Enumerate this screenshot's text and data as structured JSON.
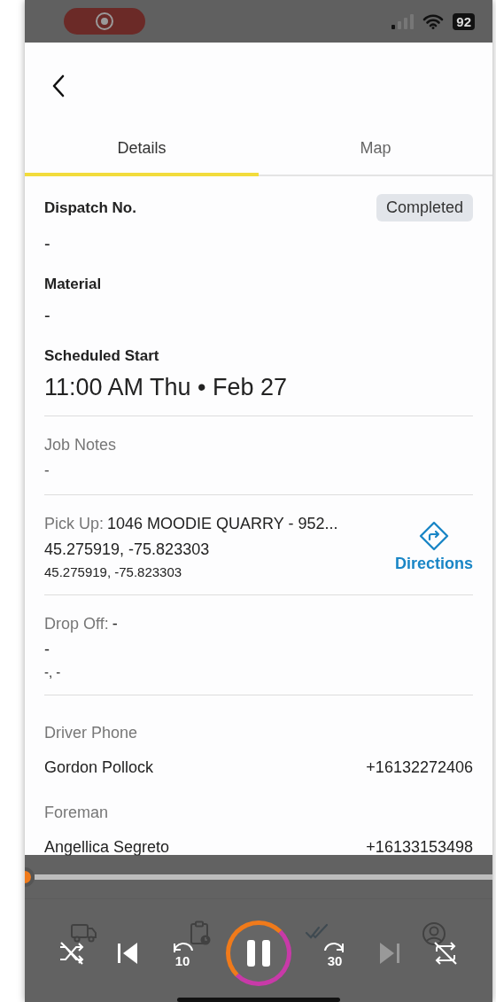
{
  "status_bar": {
    "battery": "92",
    "recording": true
  },
  "tabs": [
    {
      "label": "Details",
      "selected": true
    },
    {
      "label": "Map",
      "selected": false
    }
  ],
  "fields": [
    {
      "kind": "heading",
      "label": "Dispatch No.",
      "value": "-",
      "badge": "Completed"
    },
    {
      "kind": "heading",
      "label": "Material",
      "value": "-"
    },
    {
      "kind": "large",
      "label": "Scheduled Start",
      "value": "11:00 AM Thu • Feb 27"
    }
  ],
  "sections": [
    {
      "kind": "note",
      "label": "Job Notes",
      "lines": [
        "-"
      ]
    },
    {
      "kind": "location",
      "label": "Pick Up:",
      "name": "1046 MOODIE QUARRY - 952...",
      "lines": [
        "45.275919, -75.823303",
        "45.275919, -75.823303"
      ],
      "action": "Directions"
    },
    {
      "kind": "location",
      "label": "Drop Off:",
      "name": "-",
      "lines": [
        "-",
        "-, -"
      ]
    },
    {
      "kind": "contacts",
      "items": [
        {
          "label": "Driver Phone",
          "name": "Gordon Pollock",
          "phone": "+16132272406"
        },
        {
          "label": "Foreman",
          "name": "Angellica Segreto",
          "phone": "+16133153498"
        }
      ]
    }
  ],
  "nav": [
    {
      "selected": false
    },
    {
      "selected": false
    },
    {
      "selected": true
    },
    {
      "selected": false
    }
  ],
  "player": {
    "level": 0,
    "playing": true,
    "shuffle": false,
    "repeat": false,
    "skip_back": "10",
    "skip_forward": "30"
  }
}
